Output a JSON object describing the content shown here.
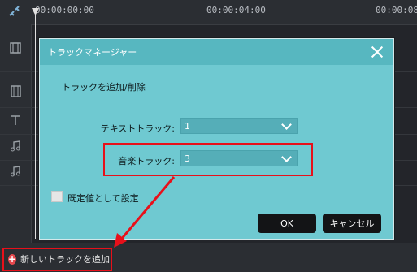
{
  "timeline": {
    "timecodes": [
      "00:00:00:00",
      "00:00:04:00",
      "00:00:08"
    ],
    "left_icons": [
      "snap-icon",
      "film-icon",
      "clip-icon",
      "text-icon",
      "music-note-icon",
      "music-note-icon"
    ]
  },
  "add_track_label": "新しいトラックを追加",
  "dialog": {
    "title": "トラックマネージャー",
    "section_label": "トラックを追加/削除",
    "fields": [
      {
        "label": "テキストトラック:",
        "value": "1"
      },
      {
        "label": "音楽トラック:",
        "value": "3"
      }
    ],
    "default_checkbox_label": "既定値として設定",
    "default_checked": false,
    "ok_label": "OK",
    "cancel_label": "キャンセル"
  },
  "colors": {
    "annotation": "#e8101a",
    "dialog_bg": "#6fc9d1",
    "dialog_title_bg": "#57b7c0",
    "select_bg": "#55aeb8",
    "button_bg": "#131416"
  }
}
